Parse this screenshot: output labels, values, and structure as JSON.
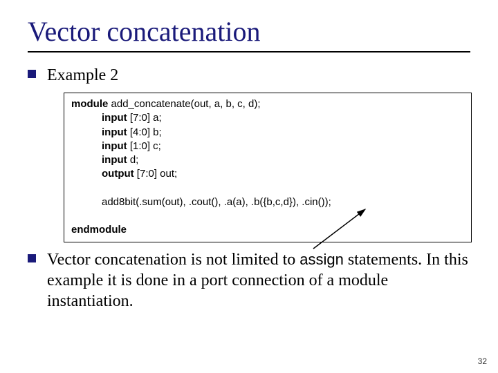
{
  "title": "Vector concatenation",
  "bullets": {
    "b1": "Example 2",
    "b2_part1": "Vector concatenation is not limited to ",
    "b2_code": "assign",
    "b2_part2": " statements.  In this example it is done in a port connection of a module instantiation."
  },
  "code": {
    "kw_module": "module",
    "mod_decl": " add_concatenate(out, a, b, c, d);",
    "kw_input": "input",
    "a_decl": " [7:0] a;",
    "b_decl": " [4:0] b;",
    "c_decl": " [1:0] c;",
    "d_decl": " d;",
    "kw_output": "output",
    "out_decl": " [7:0] out;",
    "inst_line": "add8bit(.sum(out), .cout(), .a(a), .b({b,c,d}), .cin());",
    "kw_endmodule": "endmodule"
  },
  "pagenum": "32"
}
